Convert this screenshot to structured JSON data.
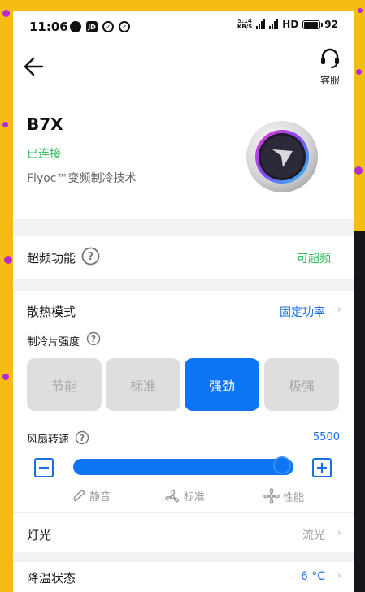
{
  "status_bar": {
    "time": "11:06",
    "speed_top": "5.14",
    "speed_bottom": "KB/S",
    "network": "HD",
    "battery": "92",
    "battery_level": 0.92
  },
  "header": {
    "service_label": "客服"
  },
  "device": {
    "name": "B7X",
    "status": "已连接",
    "tech": "Flyoc™变频制冷技术"
  },
  "overclock": {
    "label": "超频功能",
    "value": "可超频"
  },
  "cooling": {
    "mode_label": "散热模式",
    "mode_value": "固定功率",
    "intensity_label": "制冷片强度",
    "options": [
      "节能",
      "标准",
      "强劲",
      "极强"
    ],
    "selected_index": 2
  },
  "fan": {
    "label": "风扇转速",
    "value": "5500",
    "slider_fraction": 0.98,
    "presets": [
      "静音",
      "标准",
      "性能"
    ]
  },
  "light": {
    "label": "灯光",
    "value": "流光"
  },
  "cooling_status": {
    "label": "降温状态",
    "value": "6 °C"
  },
  "colors": {
    "accent": "#0d74f3",
    "connected": "#2fb85a",
    "overclock": "#2fb85a"
  }
}
